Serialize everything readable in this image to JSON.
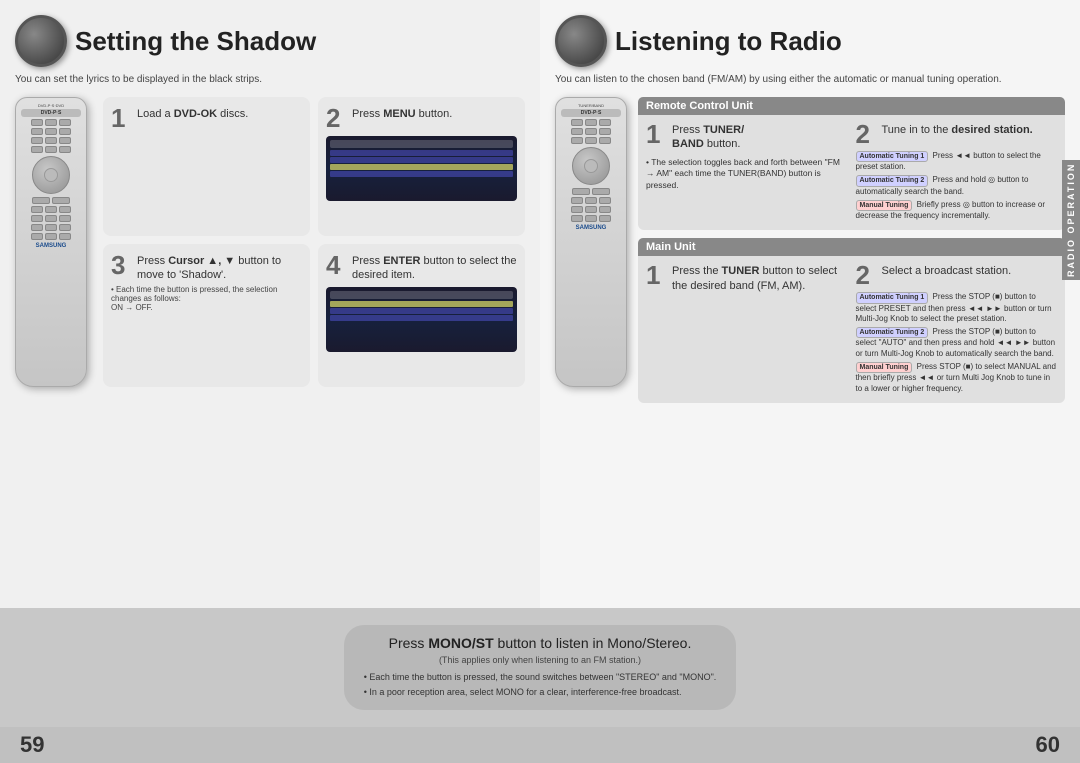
{
  "leftSection": {
    "title": "Setting the Shadow",
    "subtitle": "You can set the lyrics to be displayed in the black strips.",
    "steps": [
      {
        "number": "1",
        "text": "Load a DVD-OK discs.",
        "bold": "DVD-OK"
      },
      {
        "number": "2",
        "text": "Press MENU button.",
        "bold": "MENU"
      },
      {
        "number": "3",
        "text": "Press Cursor ▲, ▼ button to move to 'Shadow'.",
        "bold": "Cursor ▲, ▼"
      },
      {
        "number": "4",
        "text": "Press ENTER button to select the desired item.",
        "bold": "ENTER",
        "note": "• Each time the button is pressed, the selection changes as follows:\nON → OFF."
      }
    ]
  },
  "rightSection": {
    "title": "Listening to Radio",
    "subtitle": "You can listen to the chosen band (FM/AM) by using either the automatic or manual tuning operation.",
    "remoteControlUnit": {
      "header": "Remote Control Unit",
      "step1": {
        "number": "1",
        "text": "Press TUNER/ BAND button.",
        "bold": "TUNER/ BAND"
      },
      "step2": {
        "number": "2",
        "text": "Tune in to the desired station.",
        "bold": "desired station"
      },
      "bulletPoint": "The selection toggles back and forth between \"FM → AM\" each time the TUNER(BAND) button is pressed.",
      "autoTuning1": {
        "label": "Automatic Tuning 1",
        "text": "Press ◄◄ button to select the preset station."
      },
      "autoTuning2": {
        "label": "Automatic Tuning 2",
        "text": "Press and hold ⏺⏺ button to automatically search the band."
      },
      "manualTuning": {
        "label": "Manual Tuning",
        "text": "Briefly press ⏺⏺ button to increase or decrease the frequency incrementally."
      }
    },
    "mainUnit": {
      "header": "Main Unit",
      "step1": {
        "number": "1",
        "text": "Press the TUNER button to select the desired band (FM, AM).",
        "bold": "TUNER"
      },
      "step2": {
        "number": "2",
        "text": "Select a broadcast station.",
        "bold": "broadcast station"
      },
      "autoTuning1": {
        "label": "Automatic Tuning 1",
        "text": "Press the STOP (■) button to select PRESET and then press ◄◄ ►► button or turn Multi-Jog Knob to select the preset station."
      },
      "autoTuning2": {
        "label": "Automatic Tuning 2",
        "text": "Press the STOP (■) button to select \"AUTO\" and then press and hold ◄◄ ►► button or turn Multi-Jog Knob to automatically search the band."
      },
      "manualTuning": {
        "label": "Manual Tuning",
        "text": "Press STOP (■) to select MANUAL and then briefly press ◄◄ or turn Multi Jog Knob to tune in to a lower or higher frequency."
      }
    }
  },
  "bottomSection": {
    "monoStButton": {
      "prefix": "Press ",
      "boldText": "MONO/ST",
      "suffix": " button to listen in Mono/Stereo.",
      "note": "(This applies only when listening to an FM station.)",
      "bullets": [
        "Each time the button is pressed, the sound switches between \"STEREO\" and \"MONO\".",
        "In a poor reception area, select MONO for a clear, interference-free broadcast."
      ]
    }
  },
  "pageNumbers": {
    "left": "59",
    "right": "60"
  },
  "sidebar": {
    "radioOperation": "RADIO OPERATION"
  }
}
